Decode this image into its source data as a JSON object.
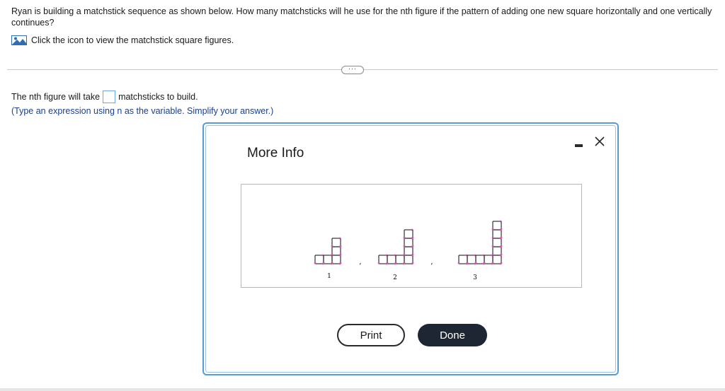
{
  "question": {
    "text": "Ryan is building a matchstick sequence as shown below. How many matchsticks will he use for the nth figure if the pattern of adding one new square horizontally and one vertically continues?"
  },
  "hint": {
    "text": "Click the icon to view the matchstick square figures."
  },
  "expand_button": {
    "label": "···"
  },
  "answer": {
    "prefix": "The nth figure will take",
    "suffix": "matchsticks to build.",
    "value": "",
    "instruction": "(Type an expression using n as the variable. Simplify your answer.)"
  },
  "dialog": {
    "title": "More Info",
    "figure_labels": [
      "1",
      "2",
      "3"
    ],
    "separators": [
      ",",
      ","
    ],
    "print_label": "Print",
    "done_label": "Done"
  },
  "colors": {
    "accent_border": "#5b9bd5",
    "input_border": "#6ea6dd",
    "instruction_text": "#1a3f8f",
    "done_bg": "#1e2633",
    "match_stick": "#333333",
    "match_head": "#d94fb3"
  }
}
